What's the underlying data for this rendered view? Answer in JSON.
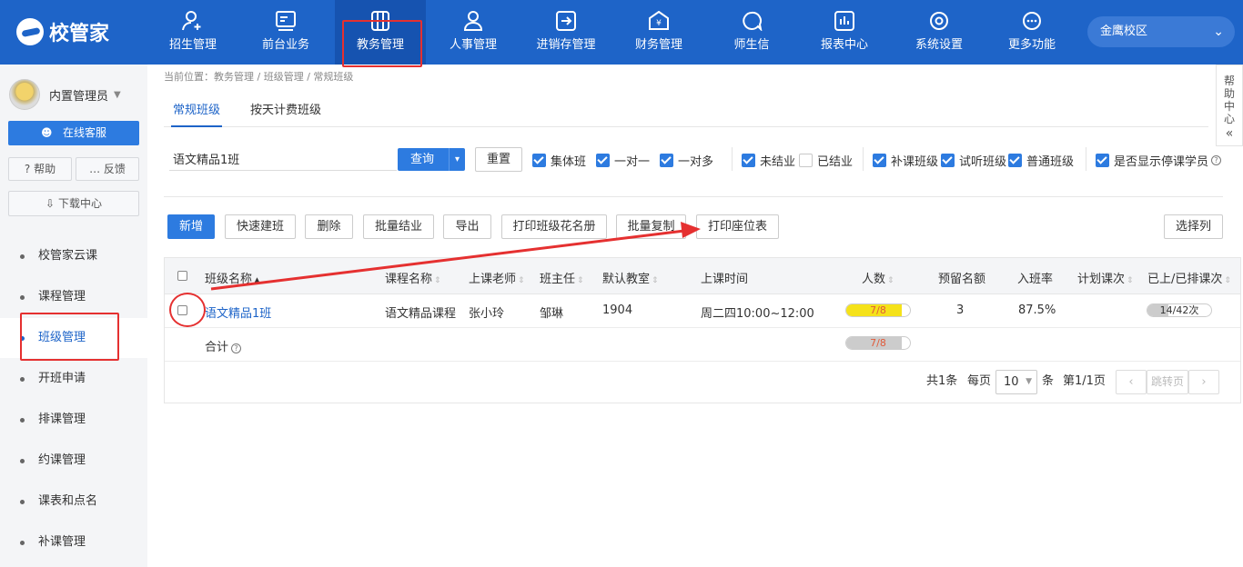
{
  "app": {
    "logo_text": "校管家"
  },
  "nav": {
    "items": [
      {
        "label": "招生管理",
        "icon": "user-plus-icon"
      },
      {
        "label": "前台业务",
        "icon": "reception-icon"
      },
      {
        "label": "教务管理",
        "icon": "academic-icon"
      },
      {
        "label": "人事管理",
        "icon": "person-icon"
      },
      {
        "label": "进销存管理",
        "icon": "inventory-icon"
      },
      {
        "label": "财务管理",
        "icon": "finance-icon"
      },
      {
        "label": "师生信",
        "icon": "chat-icon"
      },
      {
        "label": "报表中心",
        "icon": "report-icon"
      },
      {
        "label": "系统设置",
        "icon": "settings-icon"
      },
      {
        "label": "更多功能",
        "icon": "more-icon"
      }
    ],
    "active_index": 2,
    "campus": "金鹰校区"
  },
  "sidebar": {
    "user_name": "内置管理员",
    "service_label": "在线客服",
    "help_label": "帮助",
    "feedback_label": "反馈",
    "download_label": "下载中心",
    "items": [
      {
        "label": "校管家云课"
      },
      {
        "label": "课程管理"
      },
      {
        "label": "班级管理"
      },
      {
        "label": "开班申请"
      },
      {
        "label": "排课管理"
      },
      {
        "label": "约课管理"
      },
      {
        "label": "课表和点名"
      },
      {
        "label": "补课管理"
      }
    ],
    "active_index": 2
  },
  "help_panel": {
    "label": "帮助中心",
    "collapse_glyph": "«"
  },
  "breadcrumb": "当前位置：教务管理 / 班级管理 / 常规班级",
  "tabs": [
    {
      "label": "常规班级"
    },
    {
      "label": "按天计费班级"
    }
  ],
  "filters": {
    "search_value": "语文精品1班",
    "query_label": "查询",
    "reset_label": "重置",
    "checks": [
      {
        "label": "集体班",
        "checked": true
      },
      {
        "label": "一对一",
        "checked": true
      },
      {
        "label": "一对多",
        "checked": true
      },
      {
        "label": "未结业",
        "checked": true
      },
      {
        "label": "已结业",
        "checked": false
      },
      {
        "label": "补课班级",
        "checked": true
      },
      {
        "label": "试听班级",
        "checked": true
      },
      {
        "label": "普通班级",
        "checked": true
      },
      {
        "label": "是否显示停课学员",
        "checked": true
      }
    ]
  },
  "actions": [
    {
      "label": "新增"
    },
    {
      "label": "快速建班"
    },
    {
      "label": "删除"
    },
    {
      "label": "批量结业"
    },
    {
      "label": "导出"
    },
    {
      "label": "打印班级花名册"
    },
    {
      "label": "批量复制"
    },
    {
      "label": "打印座位表"
    },
    {
      "label": "选择列"
    }
  ],
  "table": {
    "headers": [
      "班级名称",
      "课程名称",
      "上课老师",
      "班主任",
      "默认教室",
      "上课时间",
      "人数",
      "预留名额",
      "入班率",
      "计划课次",
      "已上/已排课次"
    ],
    "rows": [
      {
        "class_name": "语文精品1班",
        "course": "语文精品课程",
        "teacher": "张小玲",
        "head_teacher": "邹琳",
        "room": "1904",
        "time": "周二四10:00~12:00",
        "count": "7/8",
        "count_fraction": 0.875,
        "reserved": "3",
        "rate": "87.5%",
        "planned": "",
        "progress": "14/42次",
        "progress_fraction": 0.333
      }
    ],
    "total_label": "合计",
    "total_count": "7/8",
    "total_fraction": 0.875
  },
  "pager": {
    "total": "共1条",
    "per_page_label": "每页",
    "per_page": "10",
    "unit": "条",
    "page": "第1/1页",
    "jump_label": "跳转页"
  },
  "colors": {
    "primary": "#1e64c8",
    "accent_red": "#e53030",
    "bar_yellow": "#f5e21a"
  }
}
